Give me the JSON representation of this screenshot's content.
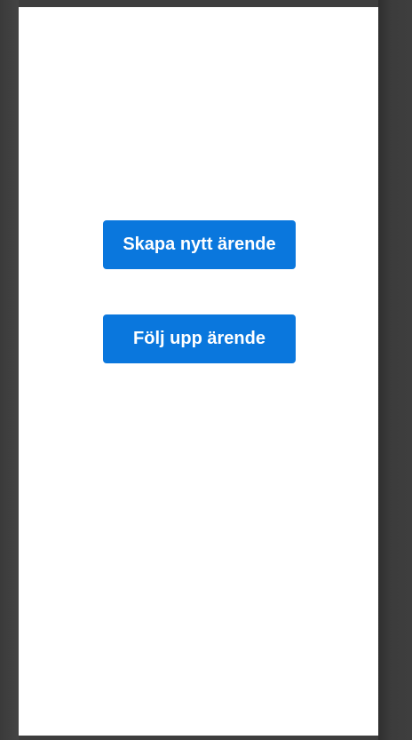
{
  "main": {
    "create_case_label": "Skapa nytt ärende",
    "follow_up_case_label": "Följ upp ärende"
  },
  "colors": {
    "accent": "#0a77dd",
    "page_background": "#ffffff",
    "outer_background": "#3e3e3e"
  }
}
